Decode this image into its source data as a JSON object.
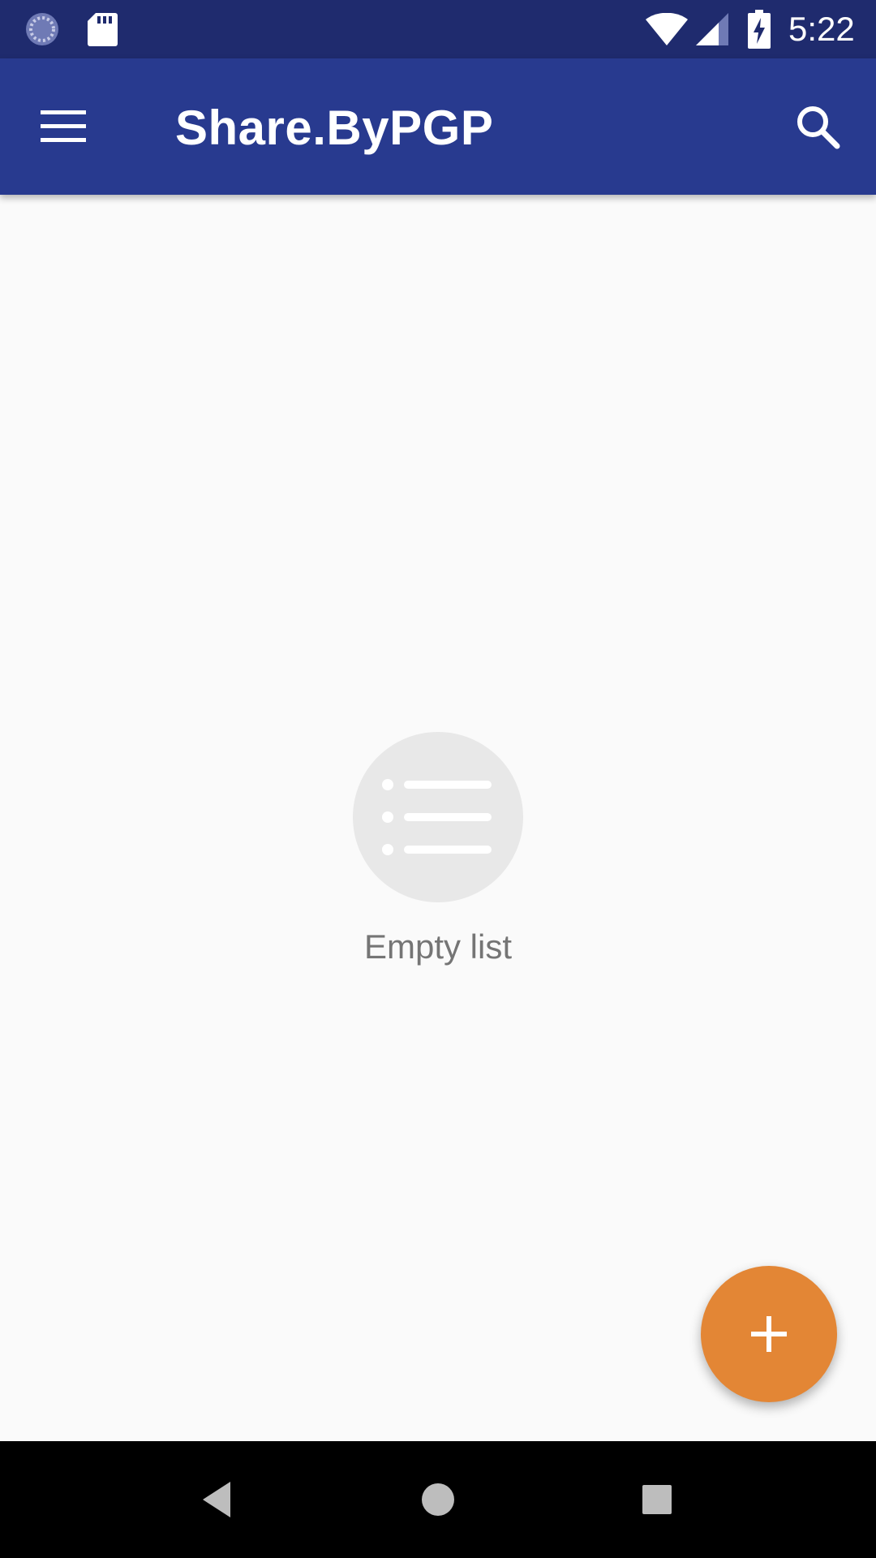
{
  "status_bar": {
    "time": "5:22",
    "icons": [
      "sync-status-icon",
      "sd-card-icon",
      "wifi-icon",
      "cell-signal-icon",
      "battery-charging-icon"
    ]
  },
  "app_bar": {
    "title": "Share.ByPGP",
    "menu_icon": "menu-icon",
    "search_icon": "search-icon",
    "background": "#283a8f"
  },
  "empty_state": {
    "icon": "list-icon",
    "text": "Empty list"
  },
  "fab": {
    "icon": "plus-icon",
    "color": "#e38635"
  },
  "nav_bar": {
    "icons": [
      "back-icon",
      "home-icon",
      "recents-icon"
    ]
  },
  "colors": {
    "status_bar": "#1f2b6e",
    "app_bar": "#283a8f",
    "background": "#fafafa",
    "accent": "#e38635"
  }
}
